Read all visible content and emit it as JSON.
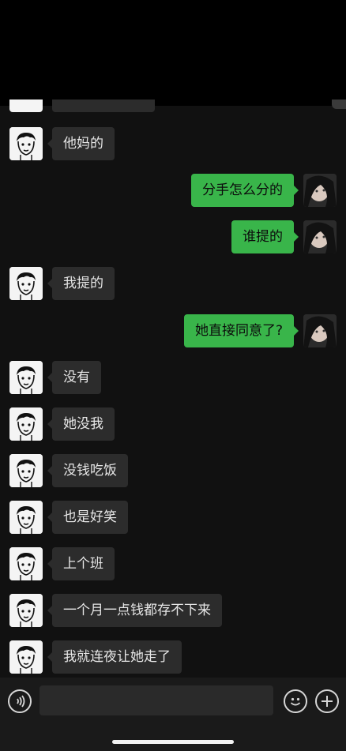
{
  "chat": {
    "messages": [
      {
        "from": "other",
        "text": "他妈的"
      },
      {
        "from": "self",
        "text": "分手怎么分的"
      },
      {
        "from": "self",
        "text": "谁提的"
      },
      {
        "from": "other",
        "text": "我提的"
      },
      {
        "from": "self",
        "text": "她直接同意了?"
      },
      {
        "from": "other",
        "text": "没有"
      },
      {
        "from": "other",
        "text": "她没我"
      },
      {
        "from": "other",
        "text": "没钱吃饭"
      },
      {
        "from": "other",
        "text": "也是好笑"
      },
      {
        "from": "other",
        "text": "上个班"
      },
      {
        "from": "other",
        "text": "一个月一点钱都存不下来"
      },
      {
        "from": "other",
        "text": "我就连夜让她走了"
      }
    ]
  },
  "input_bar": {
    "voice_icon": "voice-icon",
    "emoji_icon": "emoji-icon",
    "add_icon": "plus-icon",
    "input_value": ""
  },
  "colors": {
    "self_bubble": "#39b54a",
    "other_bubble": "#2c2c2c",
    "chat_bg": "#111111"
  }
}
